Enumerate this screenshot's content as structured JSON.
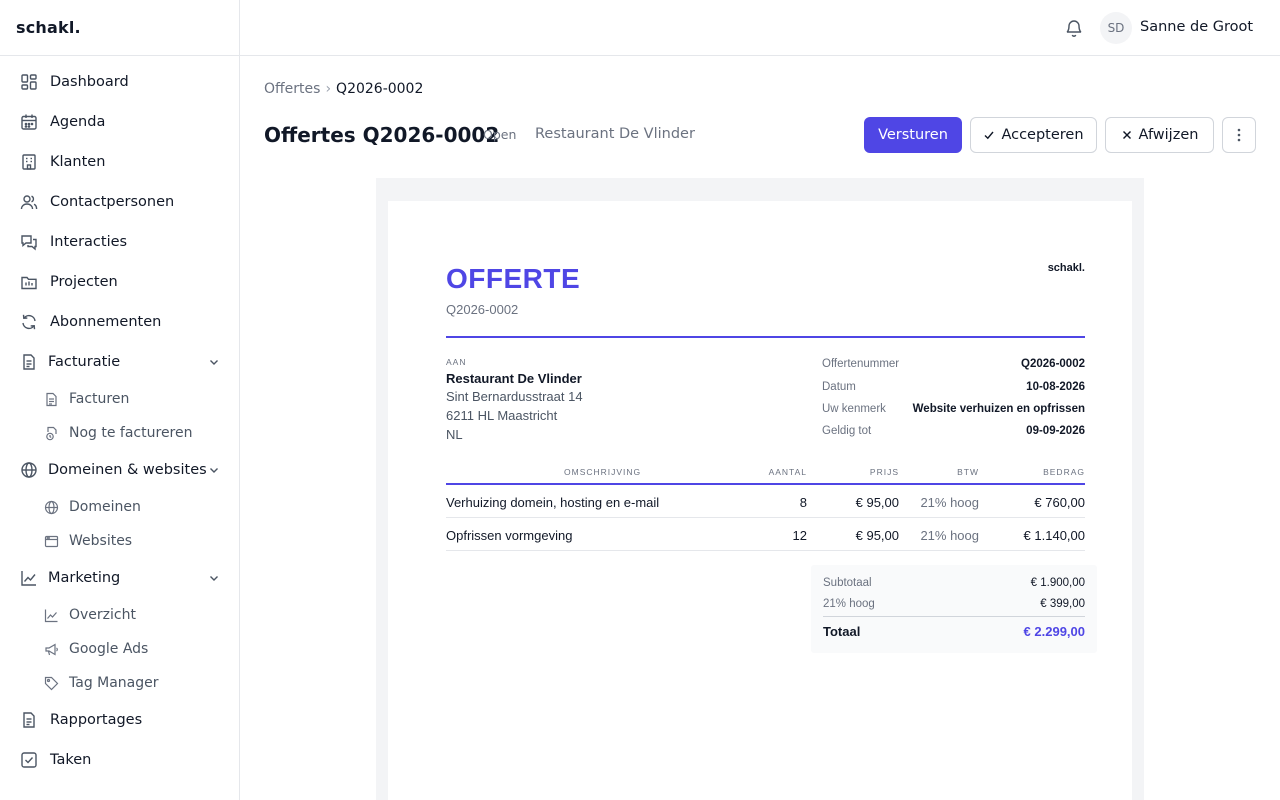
{
  "brand": "schakl.",
  "sidebar": {
    "items": [
      {
        "label": "Dashboard"
      },
      {
        "label": "Agenda"
      },
      {
        "label": "Klanten"
      },
      {
        "label": "Contactpersonen"
      },
      {
        "label": "Interacties"
      },
      {
        "label": "Projecten"
      },
      {
        "label": "Abonnementen"
      },
      {
        "label": "Facturatie"
      },
      {
        "label": "Facturen"
      },
      {
        "label": "Nog te factureren"
      },
      {
        "label": "Domeinen & websites"
      },
      {
        "label": "Domeinen"
      },
      {
        "label": "Websites"
      },
      {
        "label": "Marketing"
      },
      {
        "label": "Overzicht"
      },
      {
        "label": "Google Ads"
      },
      {
        "label": "Tag Manager"
      },
      {
        "label": "Rapportages"
      },
      {
        "label": "Taken"
      }
    ]
  },
  "topbar": {
    "avatar_initials": "SD",
    "user_name": "Sanne de Groot"
  },
  "breadcrumb": {
    "parent": "Offertes",
    "separator": "›",
    "current": "Q2026-0002"
  },
  "header": {
    "title": "Offertes Q2026-0002",
    "status": "Open",
    "client": "Restaurant De Vlinder"
  },
  "actions": {
    "send": "Versturen",
    "accept": "Accepteren",
    "reject": "Afwijzen"
  },
  "document": {
    "title": "OFFERTE",
    "number": "Q2026-0002",
    "logo": "schakl.",
    "to_label": "AAN",
    "recipient": {
      "name": "Restaurant De Vlinder",
      "street": "Sint Bernardusstraat 14",
      "city": "6211 HL Maastricht",
      "country": "NL"
    },
    "meta": [
      {
        "key": "Offertenummer",
        "value": "Q2026-0002"
      },
      {
        "key": "Datum",
        "value": "10-08-2026"
      },
      {
        "key": "Uw kenmerk",
        "value": "Website verhuizen en opfrissen"
      },
      {
        "key": "Geldig tot",
        "value": "09-09-2026"
      }
    ],
    "columns": {
      "description": "OMSCHRIJVING",
      "quantity": "AANTAL",
      "price": "PRIJS",
      "vat": "BTW",
      "amount": "BEDRAG"
    },
    "lines": [
      {
        "description": "Verhuizing domein, hosting en e-mail",
        "quantity": "8",
        "price": "€ 95,00",
        "vat": "21% hoog",
        "amount": "€ 760,00"
      },
      {
        "description": "Opfrissen vormgeving",
        "quantity": "12",
        "price": "€ 95,00",
        "vat": "21% hoog",
        "amount": "€ 1.140,00"
      }
    ],
    "totals": {
      "subtotal_label": "Subtotaal",
      "subtotal": "€ 1.900,00",
      "vat_label": "21% hoog",
      "vat": "€ 399,00",
      "total_label": "Totaal",
      "total": "€ 2.299,00"
    }
  },
  "colors": {
    "accent": "#4f46e5",
    "border": "#e5e7eb",
    "muted_text": "#6b7280"
  }
}
